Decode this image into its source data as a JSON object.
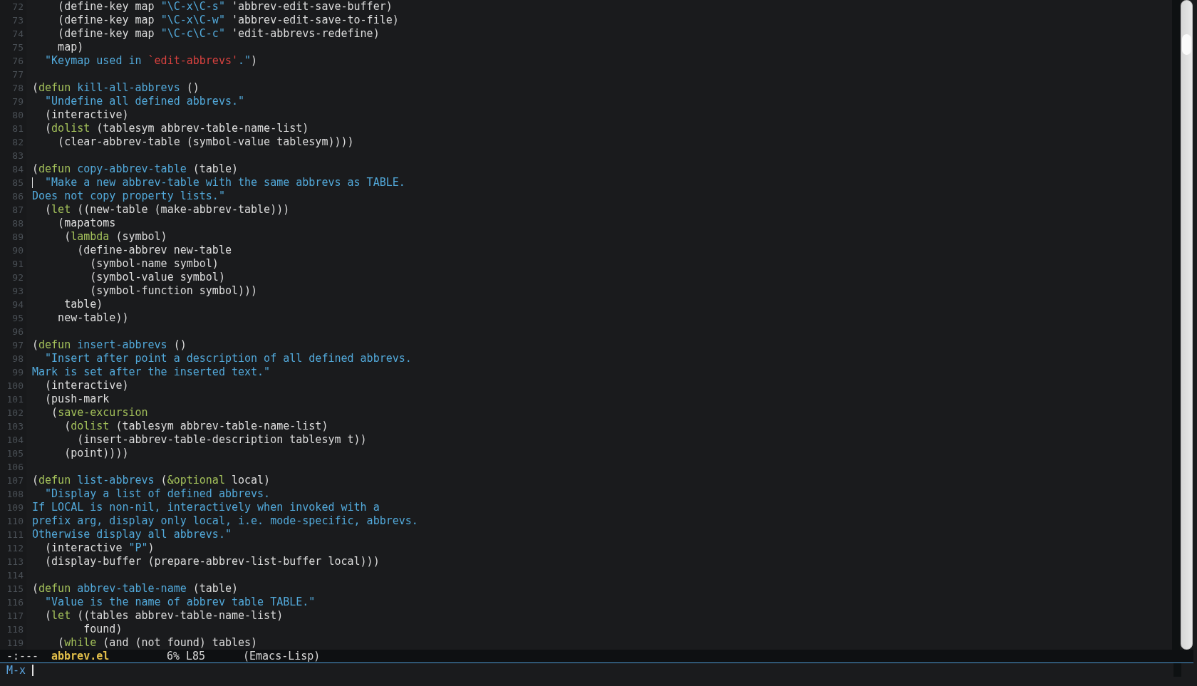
{
  "lines": [
    {
      "number": "72",
      "cursor": false,
      "segments": [
        {
          "kind": "plain",
          "text": "    (define-key map "
        },
        {
          "kind": "string",
          "text": "\"\\C-x\\C-s\""
        },
        {
          "kind": "plain",
          "text": " 'abbrev-edit-save-buffer)"
        }
      ]
    },
    {
      "number": "73",
      "cursor": false,
      "segments": [
        {
          "kind": "plain",
          "text": "    (define-key map "
        },
        {
          "kind": "string",
          "text": "\"\\C-x\\C-w\""
        },
        {
          "kind": "plain",
          "text": " 'abbrev-edit-save-to-file)"
        }
      ]
    },
    {
      "number": "74",
      "cursor": false,
      "segments": [
        {
          "kind": "plain",
          "text": "    (define-key map "
        },
        {
          "kind": "string",
          "text": "\"\\C-c\\C-c\""
        },
        {
          "kind": "plain",
          "text": " 'edit-abbrevs-redefine)"
        }
      ]
    },
    {
      "number": "75",
      "cursor": false,
      "segments": [
        {
          "kind": "plain",
          "text": "    map)"
        }
      ]
    },
    {
      "number": "76",
      "cursor": false,
      "segments": [
        {
          "kind": "string",
          "text": "  \"Keymap used in "
        },
        {
          "kind": "quoted",
          "text": "`edit-abbrevs'"
        },
        {
          "kind": "string",
          "text": ".\""
        },
        {
          "kind": "plain",
          "text": ")"
        }
      ]
    },
    {
      "number": "77",
      "cursor": false
    },
    {
      "number": "78",
      "cursor": false,
      "segments": [
        {
          "kind": "plain",
          "text": "("
        },
        {
          "kind": "keyword",
          "text": "defun"
        },
        {
          "kind": "name",
          "text": " kill-all-abbrevs"
        },
        {
          "kind": "plain",
          "text": " ()"
        }
      ]
    },
    {
      "number": "79",
      "cursor": false,
      "segments": [
        {
          "kind": "string",
          "text": "  \"Undefine all defined abbrevs.\""
        }
      ]
    },
    {
      "number": "80",
      "cursor": false,
      "segments": [
        {
          "kind": "plain",
          "text": "  (interactive)"
        }
      ]
    },
    {
      "number": "81",
      "cursor": false,
      "segments": [
        {
          "kind": "plain",
          "text": "  ("
        },
        {
          "kind": "keyword",
          "text": "dolist"
        },
        {
          "kind": "plain",
          "text": " (tablesym abbrev-table-name-list)"
        }
      ]
    },
    {
      "number": "82",
      "cursor": false,
      "segments": [
        {
          "kind": "plain",
          "text": "    (clear-abbrev-table (symbol-value tablesym))))"
        }
      ]
    },
    {
      "number": "83",
      "cursor": false
    },
    {
      "number": "84",
      "cursor": false,
      "segments": [
        {
          "kind": "plain",
          "text": "("
        },
        {
          "kind": "keyword",
          "text": "defun"
        },
        {
          "kind": "name",
          "text": " copy-abbrev-table"
        },
        {
          "kind": "plain",
          "text": " (table)"
        }
      ]
    },
    {
      "number": "85",
      "cursor": true,
      "segments": [
        {
          "kind": "string",
          "text": "  \"Make a new abbrev-table with the same abbrevs as TABLE."
        }
      ]
    },
    {
      "number": "86",
      "cursor": false,
      "segments": [
        {
          "kind": "string",
          "text": "Does not copy property lists.\""
        }
      ]
    },
    {
      "number": "87",
      "cursor": false,
      "segments": [
        {
          "kind": "plain",
          "text": "  ("
        },
        {
          "kind": "keyword",
          "text": "let"
        },
        {
          "kind": "plain",
          "text": " ((new-table (make-abbrev-table)))"
        }
      ]
    },
    {
      "number": "88",
      "cursor": false,
      "segments": [
        {
          "kind": "plain",
          "text": "    (mapatoms"
        }
      ]
    },
    {
      "number": "89",
      "cursor": false,
      "segments": [
        {
          "kind": "plain",
          "text": "     ("
        },
        {
          "kind": "keyword",
          "text": "lambda"
        },
        {
          "kind": "plain",
          "text": " (symbol)"
        }
      ]
    },
    {
      "number": "90",
      "cursor": false,
      "segments": [
        {
          "kind": "plain",
          "text": "       (define-abbrev new-table"
        }
      ]
    },
    {
      "number": "91",
      "cursor": false,
      "segments": [
        {
          "kind": "plain",
          "text": "         (symbol-name symbol)"
        }
      ]
    },
    {
      "number": "92",
      "cursor": false,
      "segments": [
        {
          "kind": "plain",
          "text": "         (symbol-value symbol)"
        }
      ]
    },
    {
      "number": "93",
      "cursor": false,
      "segments": [
        {
          "kind": "plain",
          "text": "         (symbol-function symbol)))"
        }
      ]
    },
    {
      "number": "94",
      "cursor": false,
      "segments": [
        {
          "kind": "plain",
          "text": "     table)"
        }
      ]
    },
    {
      "number": "95",
      "cursor": false,
      "segments": [
        {
          "kind": "plain",
          "text": "    new-table))"
        }
      ]
    },
    {
      "number": "96",
      "cursor": false
    },
    {
      "number": "97",
      "cursor": false,
      "segments": [
        {
          "kind": "plain",
          "text": "("
        },
        {
          "kind": "keyword",
          "text": "defun"
        },
        {
          "kind": "name",
          "text": " insert-abbrevs"
        },
        {
          "kind": "plain",
          "text": " ()"
        }
      ]
    },
    {
      "number": "98",
      "cursor": false,
      "segments": [
        {
          "kind": "string",
          "text": "  \"Insert after point a description of all defined abbrevs."
        }
      ]
    },
    {
      "number": "99",
      "cursor": false,
      "segments": [
        {
          "kind": "string",
          "text": "Mark is set after the inserted text.\""
        }
      ]
    },
    {
      "number": "100",
      "cursor": false,
      "segments": [
        {
          "kind": "plain",
          "text": "  (interactive)"
        }
      ]
    },
    {
      "number": "101",
      "cursor": false,
      "segments": [
        {
          "kind": "plain",
          "text": "  (push-mark"
        }
      ]
    },
    {
      "number": "102",
      "cursor": false,
      "segments": [
        {
          "kind": "plain",
          "text": "   ("
        },
        {
          "kind": "keyword",
          "text": "save-excursion"
        }
      ]
    },
    {
      "number": "103",
      "cursor": false,
      "segments": [
        {
          "kind": "plain",
          "text": "     ("
        },
        {
          "kind": "keyword",
          "text": "dolist"
        },
        {
          "kind": "plain",
          "text": " (tablesym abbrev-table-name-list)"
        }
      ]
    },
    {
      "number": "104",
      "cursor": false,
      "segments": [
        {
          "kind": "plain",
          "text": "       (insert-abbrev-table-description tablesym t))"
        }
      ]
    },
    {
      "number": "105",
      "cursor": false,
      "segments": [
        {
          "kind": "plain",
          "text": "     (point))))"
        }
      ]
    },
    {
      "number": "106",
      "cursor": false
    },
    {
      "number": "107",
      "cursor": false,
      "segments": [
        {
          "kind": "plain",
          "text": "("
        },
        {
          "kind": "keyword",
          "text": "defun"
        },
        {
          "kind": "name",
          "text": " list-abbrevs"
        },
        {
          "kind": "plain",
          "text": " ("
        },
        {
          "kind": "keyword",
          "text": "&optional"
        },
        {
          "kind": "plain",
          "text": " local)"
        }
      ]
    },
    {
      "number": "108",
      "cursor": false,
      "segments": [
        {
          "kind": "string",
          "text": "  \"Display a list of defined abbrevs."
        }
      ]
    },
    {
      "number": "109",
      "cursor": false,
      "segments": [
        {
          "kind": "string",
          "text": "If LOCAL is non-nil, interactively when invoked with a"
        }
      ]
    },
    {
      "number": "110",
      "cursor": false,
      "segments": [
        {
          "kind": "string",
          "text": "prefix arg, display only local, i.e. mode-specific, abbrevs."
        }
      ]
    },
    {
      "number": "111",
      "cursor": false,
      "segments": [
        {
          "kind": "string",
          "text": "Otherwise display all abbrevs.\""
        }
      ]
    },
    {
      "number": "112",
      "cursor": false,
      "segments": [
        {
          "kind": "plain",
          "text": "  (interactive "
        },
        {
          "kind": "string",
          "text": "\"P\""
        },
        {
          "kind": "plain",
          "text": ")"
        }
      ]
    },
    {
      "number": "113",
      "cursor": false,
      "segments": [
        {
          "kind": "plain",
          "text": "  (display-buffer (prepare-abbrev-list-buffer local)))"
        }
      ]
    },
    {
      "number": "114",
      "cursor": false
    },
    {
      "number": "115",
      "cursor": false,
      "segments": [
        {
          "kind": "plain",
          "text": "("
        },
        {
          "kind": "keyword",
          "text": "defun"
        },
        {
          "kind": "name",
          "text": " abbrev-table-name"
        },
        {
          "kind": "plain",
          "text": " (table)"
        }
      ]
    },
    {
      "number": "116",
      "cursor": false,
      "segments": [
        {
          "kind": "string",
          "text": "  \"Value is the name of abbrev table TABLE.\""
        }
      ]
    },
    {
      "number": "117",
      "cursor": false,
      "segments": [
        {
          "kind": "plain",
          "text": "  ("
        },
        {
          "kind": "keyword",
          "text": "let"
        },
        {
          "kind": "plain",
          "text": " ((tables abbrev-table-name-list)"
        }
      ]
    },
    {
      "number": "118",
      "cursor": false,
      "segments": [
        {
          "kind": "plain",
          "text": "        found)"
        }
      ]
    },
    {
      "number": "119",
      "cursor": false,
      "segments": [
        {
          "kind": "plain",
          "text": "    ("
        },
        {
          "kind": "keyword",
          "text": "while"
        },
        {
          "kind": "plain",
          "text": " (and (not found) tables)"
        }
      ]
    }
  ],
  "mode_line": {
    "status": "-:---",
    "buffer": "abbrev.el",
    "percent": "6%",
    "line": "L85",
    "mode": "(Emacs-Lisp)"
  },
  "minibuffer": {
    "prompt": "M-x"
  }
}
